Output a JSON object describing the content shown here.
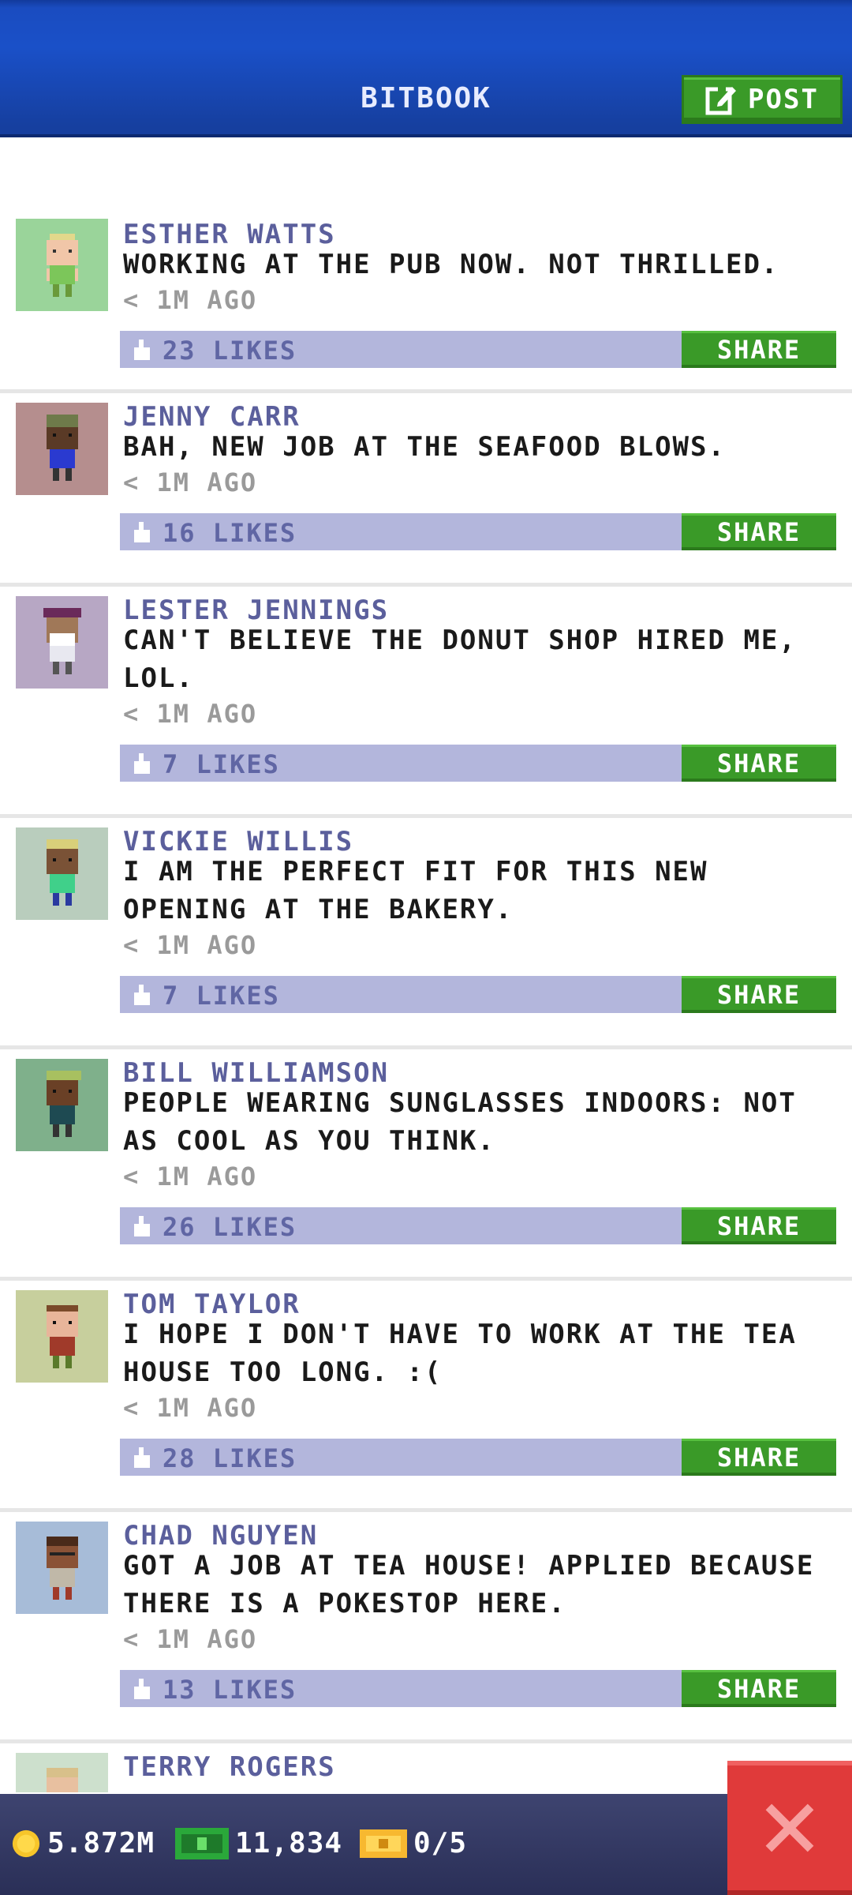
{
  "header": {
    "title": "BITBOOK",
    "post_label": "POST"
  },
  "posts": [
    {
      "name": "ESTHER WATTS",
      "message": "WORKING AT THE PUB NOW. NOT THRILLED.",
      "time": "< 1M AGO",
      "likes": "23 LIKES",
      "share": "SHARE",
      "avatar_bg": "#9ad49a"
    },
    {
      "name": "JENNY CARR",
      "message": "BAH, NEW JOB AT THE SEAFOOD BLOWS.",
      "time": "< 1M AGO",
      "likes": "16 LIKES",
      "share": "SHARE",
      "avatar_bg": "#b58e8e"
    },
    {
      "name": "LESTER JENNINGS",
      "message": "CAN'T BELIEVE THE DONUT SHOP HIRED ME, LOL.",
      "time": "< 1M AGO",
      "likes": "7 LIKES",
      "share": "SHARE",
      "avatar_bg": "#b7a7c4"
    },
    {
      "name": "VICKIE WILLIS",
      "message": "I AM THE PERFECT FIT FOR THIS NEW OPENING AT THE BAKERY.",
      "time": "< 1M AGO",
      "likes": "7 LIKES",
      "share": "SHARE",
      "avatar_bg": "#b9cdbd"
    },
    {
      "name": "BILL WILLIAMSON",
      "message": "PEOPLE WEARING SUNGLASSES INDOORS: NOT AS COOL AS YOU THINK.",
      "time": "< 1M AGO",
      "likes": "26 LIKES",
      "share": "SHARE",
      "avatar_bg": "#7fb08b"
    },
    {
      "name": "TOM TAYLOR",
      "message": "I HOPE I DON'T HAVE TO WORK AT THE TEA HOUSE TOO LONG. :(",
      "time": "< 1M AGO",
      "likes": "28 LIKES",
      "share": "SHARE",
      "avatar_bg": "#c7cf9d"
    },
    {
      "name": "CHAD NGUYEN",
      "message": "GOT A JOB AT TEA HOUSE! APPLIED BECAUSE THERE IS A POKESTOP HERE.",
      "time": "< 1M AGO",
      "likes": "13 LIKES",
      "share": "SHARE",
      "avatar_bg": "#a7bcd8"
    },
    {
      "name": "TERRY ROGERS",
      "avatar_bg": "#cde0cd"
    }
  ],
  "status": {
    "coins": "5.872M",
    "bux": "11,834",
    "tickets": "0/5"
  },
  "colors": {
    "header_blue": "#1a4cc0",
    "share_green": "#3a9a28",
    "likes_bar": "#b3b6dc",
    "close_red": "#e03a3a"
  },
  "icons": [
    "edit-icon",
    "thumbs-up-icon",
    "coin-icon",
    "bux-icon",
    "ticket-icon",
    "close-icon"
  ]
}
